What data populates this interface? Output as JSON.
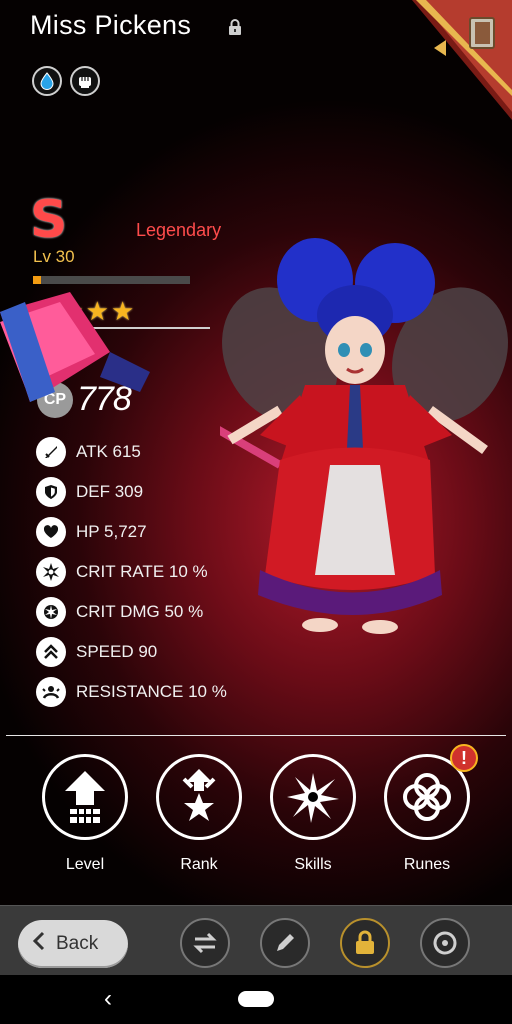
{
  "header": {
    "title": "Miss Pickens",
    "elements": [
      "water-drop-icon",
      "fist-icon"
    ]
  },
  "hero": {
    "rank_letter": "S",
    "rarity": "Legendary",
    "level": "Lv 30",
    "xp_fraction": 0.05,
    "stars": 4,
    "cp_badge": "CP",
    "cp_value": "778"
  },
  "stats": [
    {
      "icon": "sword-icon",
      "label": "ATK 615"
    },
    {
      "icon": "shield-icon",
      "label": "DEF 309"
    },
    {
      "icon": "heart-icon",
      "label": "HP 5,727"
    },
    {
      "icon": "crit-rate-icon",
      "label": "CRIT RATE 10 %"
    },
    {
      "icon": "crit-dmg-icon",
      "label": "CRIT DMG 50 %"
    },
    {
      "icon": "speed-icon",
      "label": "SPEED 90"
    },
    {
      "icon": "resistance-icon",
      "label": "RESISTANCE 10 %"
    }
  ],
  "actions": [
    {
      "label": "Level",
      "icon": "level-up-arrow-icon"
    },
    {
      "label": "Rank",
      "icon": "rank-star-icon"
    },
    {
      "label": "Skills",
      "icon": "skills-burst-icon"
    },
    {
      "label": "Runes",
      "icon": "runes-rings-icon",
      "alert": "!"
    }
  ],
  "bottom_bar": {
    "back_label": "Back",
    "buttons": [
      "swap-icon",
      "pencil-icon",
      "lock-icon",
      "recycle-icon"
    ]
  },
  "colors": {
    "rarity": "#ff4c4c",
    "level": "#f2c14e",
    "star": "#f7b520",
    "alert": "#d0322d"
  }
}
